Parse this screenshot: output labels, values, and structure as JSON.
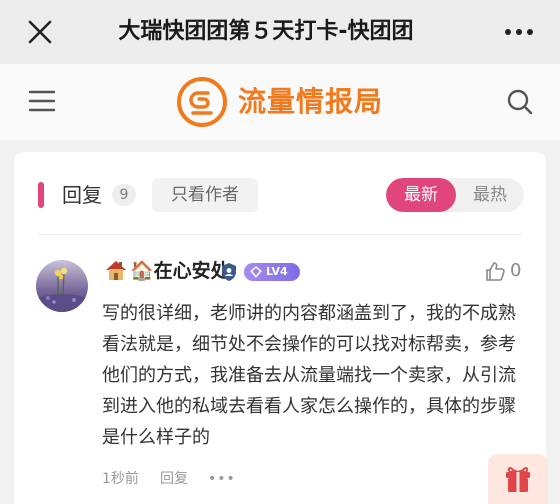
{
  "titlebar": {
    "title": "大瑞快团团第５天打卡-快团团",
    "close_icon": "close-icon",
    "more_icon": "more-icon"
  },
  "site": {
    "logo_text": "流量情报局",
    "brand_color": "#f07a1e",
    "menu_icon": "hamburger-menu-icon",
    "search_icon": "search-icon"
  },
  "comments_header": {
    "reply_label": "回复",
    "reply_count": "9",
    "author_only_label": "只看作者",
    "sort_tabs": [
      {
        "label": "最新",
        "active": true
      },
      {
        "label": "最热",
        "active": false
      }
    ],
    "accent_color": "#e0457b"
  },
  "comment": {
    "username": "🏠在心安处",
    "level_label": "LV4",
    "like_count": "0",
    "text": "写的很详细，老师讲的内容都涵盖到了，我的不成熟看法就是，细节处不会操作的可以找对标帮卖，参考他们的方式，我准备去从流量端找一个卖家，从引流到进入他的私域去看看人家怎么操作的，具体的步骤是什么样子的",
    "time": "1秒前",
    "reply_link": "回复",
    "more": "•••"
  },
  "gift": {
    "icon": "gift-icon"
  }
}
